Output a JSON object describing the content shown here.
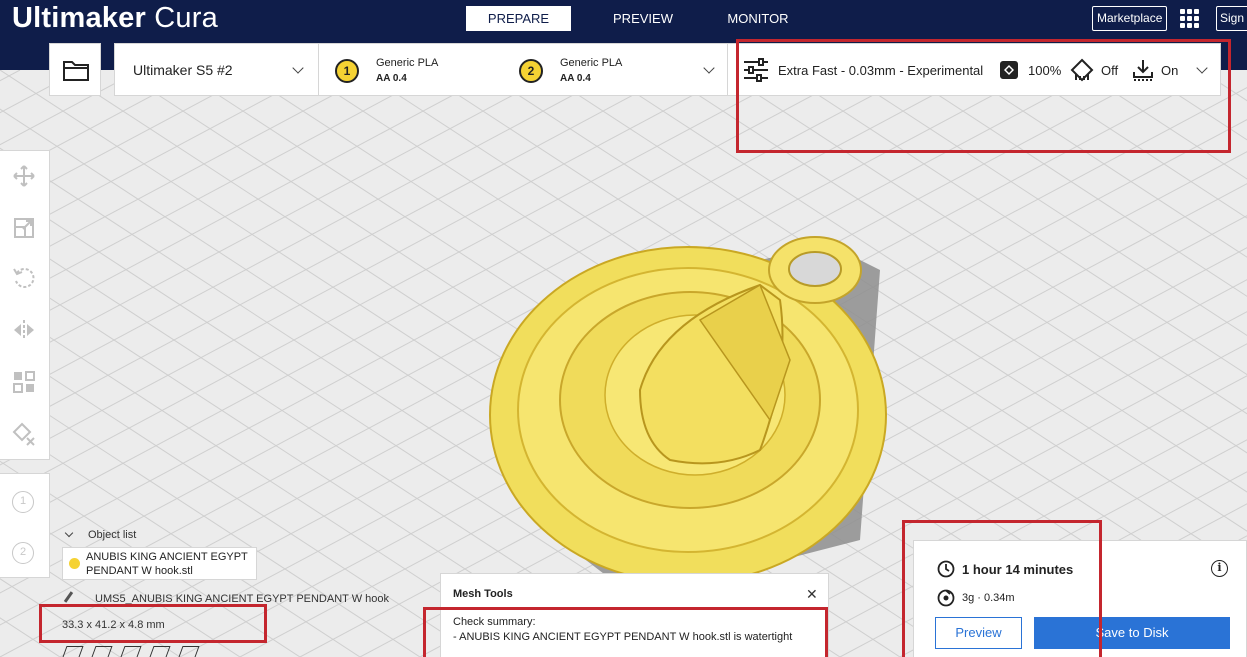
{
  "app": {
    "brand_bold": "Ultimaker",
    "brand_light": " Cura"
  },
  "stages": [
    {
      "label": "PREPARE",
      "active": true
    },
    {
      "label": "PREVIEW",
      "active": false
    },
    {
      "label": "MONITOR",
      "active": false
    }
  ],
  "header": {
    "marketplace_label": "Marketplace",
    "sign_in_label": "Sign"
  },
  "printer": {
    "name": "Ultimaker S5 #2"
  },
  "extruders": [
    {
      "index": "1",
      "material": "Generic PLA",
      "core": "AA 0.4"
    },
    {
      "index": "2",
      "material": "Generic PLA",
      "core": "AA 0.4"
    }
  ],
  "print_settings": {
    "profile": "Extra Fast - 0.03mm - Experimental",
    "infill": "100%",
    "support": "Off",
    "adhesion": "On"
  },
  "extruder_ghosts": [
    "1",
    "2"
  ],
  "object_list": {
    "header": "Object list",
    "item_line1": "ANUBIS KING ANCIENT EGYPT",
    "item_line2": "PENDANT W hook.stl",
    "path": "UMS5_ANUBIS KING ANCIENT EGYPT PENDANT W hook",
    "dimensions": "33.3 x 41.2 x 4.8 mm"
  },
  "mesh_tools": {
    "title": "Mesh Tools",
    "summary_label": "Check summary:",
    "line1": "- ANUBIS KING ANCIENT EGYPT PENDANT W hook.stl is watertight"
  },
  "estimate": {
    "time": "1 hour 14 minutes",
    "material": "3g · 0.34m",
    "preview_label": "Preview",
    "save_label": "Save to Disk"
  },
  "colors": {
    "header": "#0f1d4a",
    "accent": "#2a73d6",
    "model": "#f5d233",
    "highlight": "#c4262e"
  }
}
